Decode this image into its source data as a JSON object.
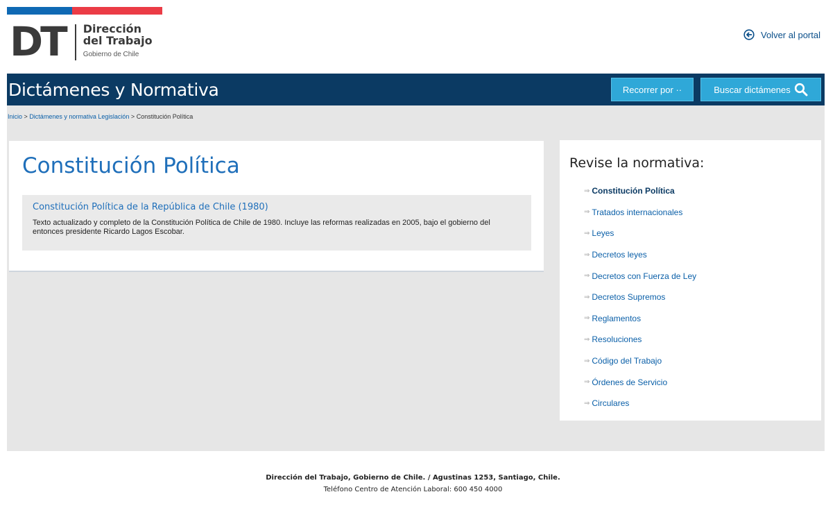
{
  "header": {
    "logo_letters": "DT",
    "logo_line1": "Dirección",
    "logo_line2": "del Trabajo",
    "logo_sub": "Gobierno de Chile",
    "back_link": "Volver al portal",
    "flag_colors": [
      "#0f69b4",
      "#eb3c46"
    ]
  },
  "titlebar": {
    "title": "Dictámenes y Normativa",
    "browse_button": "Recorrer por ··",
    "search_button": "Buscar dictámenes",
    "search_icon": "search-icon",
    "background": "#0b3a63",
    "button_color": "#2fa8d8"
  },
  "breadcrumb": {
    "items": [
      "Inicio",
      "Dictámenes y normativa",
      "Legislación"
    ],
    "separator": ">",
    "current": "Constitución Política"
  },
  "main": {
    "title": "Constitución Política",
    "document": {
      "title": "Constitución Política de la República de Chile (1980)",
      "description": "Texto actualizado y completo de la Constitución Política de Chile de 1980. Incluye las reformas realizadas en 2005, bajo el gobierno del entonces presidente Ricardo Lagos Escobar."
    }
  },
  "sidebar": {
    "title": "Revise la normativa:",
    "arrow_glyph": "⇒",
    "items": [
      {
        "label": "Constitución Política",
        "active": true
      },
      {
        "label": "Tratados internacionales"
      },
      {
        "label": "Leyes"
      },
      {
        "label": "Decretos leyes"
      },
      {
        "label": "Decretos con Fuerza de Ley"
      },
      {
        "label": "Decretos Supremos"
      },
      {
        "label": "Reglamentos"
      },
      {
        "label": "Resoluciones"
      },
      {
        "label": "Código del Trabajo"
      },
      {
        "label": "Órdenes de Servicio"
      },
      {
        "label": "Circulares"
      }
    ]
  },
  "footer": {
    "line1": "Dirección del Trabajo, Gobierno de Chile. / Agustinas 1253, Santiago, Chile.",
    "line2": "Teléfono Centro de Atención Laboral: 600 450 4000"
  }
}
